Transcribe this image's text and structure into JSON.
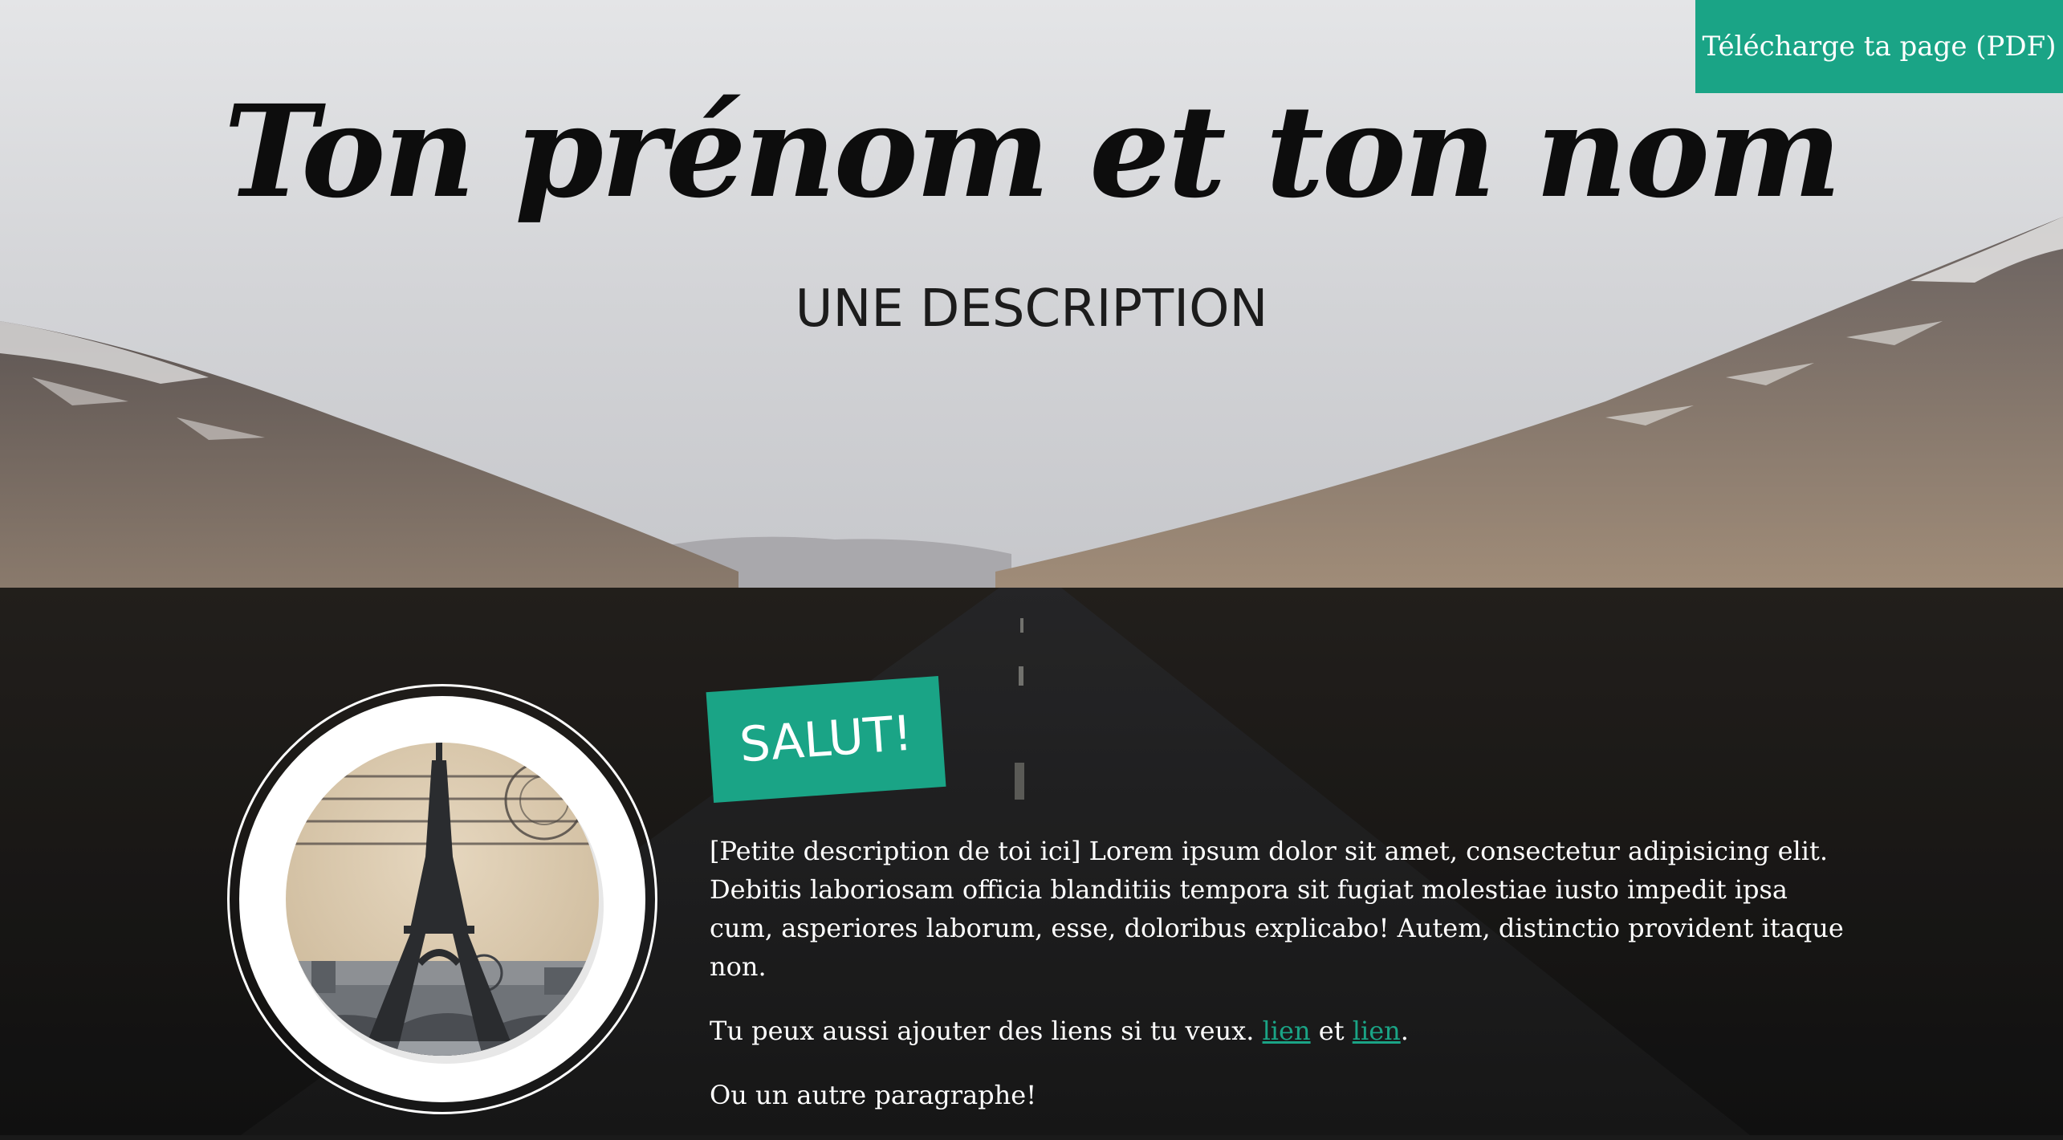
{
  "header": {
    "download_label": "Télécharge ta page (PDF)",
    "title": "Ton prénom et ton nom",
    "subtitle": "UNE DESCRIPTION"
  },
  "about": {
    "badge": "SALUT!",
    "paragraph1": "[Petite description de toi ici] Lorem ipsum dolor sit amet, consectetur adipisicing elit. Debitis laboriosam officia blanditiis tempora sit fugiat molestiae iusto impedit ipsa cum, asperiores laborum, esse, doloribus explicabo! Autem, distinctio provident itaque non.",
    "links_intro": "Tu peux aussi ajouter des liens si tu veux.",
    "link1": "lien",
    "links_and": "et",
    "link2": "lien",
    "links_end": ".",
    "paragraph3": "Ou un autre paragraphe!"
  },
  "colors": {
    "accent": "#1aa486",
    "title_text": "#0d0d0d",
    "body_text": "#ffffff"
  },
  "icons": {
    "profile_picture": "eiffel-tower-postcard"
  }
}
